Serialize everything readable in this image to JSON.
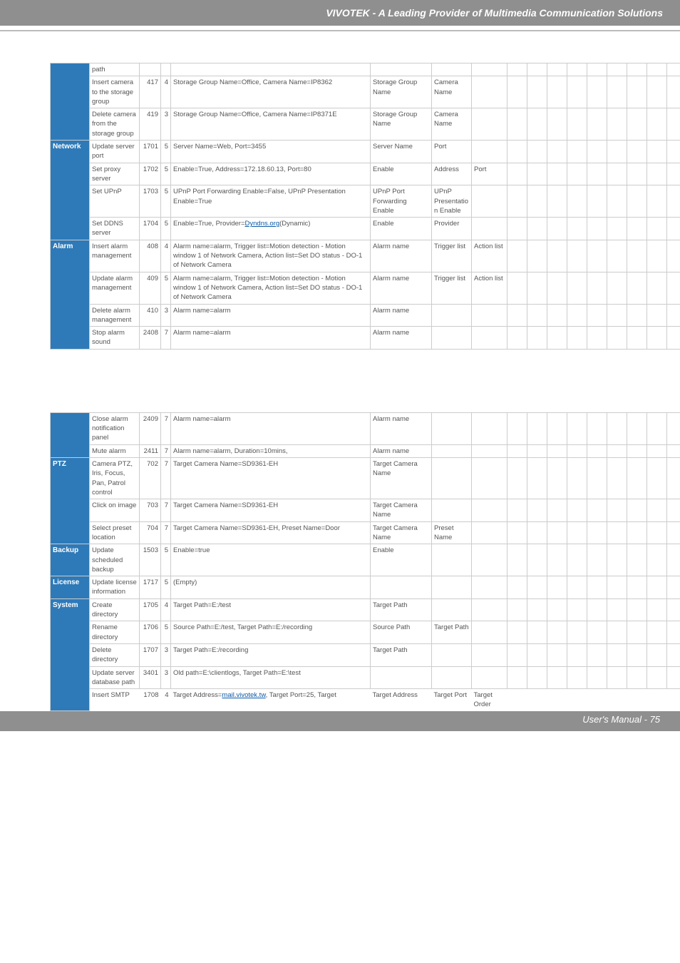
{
  "header": {
    "title": "VIVOTEK - A Leading Provider of Multimedia Communication Solutions"
  },
  "footer": {
    "text": "User's Manual - 75"
  },
  "table1": {
    "rows": [
      {
        "cat": "",
        "action": "path",
        "id": "",
        "n": "",
        "desc": "",
        "p1": "",
        "p2": "",
        "p3": ""
      },
      {
        "cat": "",
        "action": "Insert camera to the storage group",
        "id": "417",
        "n": "4",
        "desc": "Storage Group Name=Office, Camera Name=IP8362",
        "p1": "Storage Group Name",
        "p2": "Camera Name",
        "p3": ""
      },
      {
        "cat": "",
        "action": "Delete camera from the storage group",
        "id": "419",
        "n": "3",
        "desc": "Storage Group Name=Office, Camera Name=IP8371E",
        "p1": "Storage Group Name",
        "p2": "Camera Name",
        "p3": ""
      },
      {
        "cat": "Network",
        "action": "Update server port",
        "id": "1701",
        "n": "5",
        "desc": "Server Name=Web, Port=3455",
        "p1": "Server Name",
        "p2": "Port",
        "p3": ""
      },
      {
        "cat": "",
        "action": "Set proxy server",
        "id": "1702",
        "n": "5",
        "desc": "Enable=True, Address=172.18.60.13, Port=80",
        "p1": "Enable",
        "p2": "Address",
        "p3": "Port"
      },
      {
        "cat": "",
        "action": "Set UPnP",
        "id": "1703",
        "n": "5",
        "desc": "UPnP Port Forwarding Enable=False, UPnP Presentation Enable=True",
        "p1": "UPnP Port Forwarding Enable",
        "p2": "UPnP Presentation Enable",
        "p3": ""
      },
      {
        "cat": "",
        "action": "Set DDNS server",
        "id": "1704",
        "n": "5",
        "desc_prefix": "Enable=True, Provider=",
        "desc_link": "Dyndns.org",
        "desc_suffix": "(Dynamic)",
        "p1": "Enable",
        "p2": "Provider",
        "p3": ""
      },
      {
        "cat": "Alarm",
        "action": "Insert alarm management",
        "id": "408",
        "n": "4",
        "desc": "Alarm name=alarm, Trigger list=Motion detection - Motion window 1 of Network Camera, Action list=Set DO status - DO-1 of Network Camera",
        "p1": "Alarm name",
        "p2": "Trigger list",
        "p3": "Action list"
      },
      {
        "cat": "",
        "action": "Update alarm management",
        "id": "409",
        "n": "5",
        "desc": "Alarm name=alarm, Trigger list=Motion detection - Motion window 1 of Network Camera, Action list=Set DO status - DO-1 of Network Camera",
        "p1": "Alarm name",
        "p2": "Trigger list",
        "p3": "Action list"
      },
      {
        "cat": "",
        "action": "Delete alarm management",
        "id": "410",
        "n": "3",
        "desc": "Alarm name=alarm",
        "p1": "Alarm name",
        "p2": "",
        "p3": ""
      },
      {
        "cat": "",
        "action": "Stop alarm sound",
        "id": "2408",
        "n": "7",
        "desc": "Alarm name=alarm",
        "p1": "Alarm name",
        "p2": "",
        "p3": ""
      }
    ]
  },
  "table2": {
    "rows": [
      {
        "cat": "",
        "action": "Close alarm notification panel",
        "id": "2409",
        "n": "7",
        "desc": "Alarm name=alarm",
        "p1": "Alarm name",
        "p2": "",
        "p3": ""
      },
      {
        "cat": "",
        "action": "Mute alarm",
        "id": "2411",
        "n": "7",
        "desc": "Alarm name=alarm, Duration=10mins,",
        "p1": "Alarm name",
        "p2": "",
        "p3": ""
      },
      {
        "cat": "PTZ",
        "action": "Camera PTZ, Iris, Focus, Pan, Patrol control",
        "id": "702",
        "n": "7",
        "desc": "Target Camera Name=SD9361-EH",
        "p1": "Target Camera Name",
        "p2": "",
        "p3": ""
      },
      {
        "cat": "",
        "action": "Click on image",
        "id": "703",
        "n": "7",
        "desc": "Target Camera Name=SD9361-EH",
        "p1": "Target Camera Name",
        "p2": "",
        "p3": ""
      },
      {
        "cat": "",
        "action": "Select preset location",
        "id": "704",
        "n": "7",
        "desc": "Target Camera Name=SD9361-EH, Preset Name=Door",
        "p1": "Target Camera Name",
        "p2": "Preset Name",
        "p3": ""
      },
      {
        "cat": "Backup",
        "action": "Update scheduled backup",
        "id": "1503",
        "n": "5",
        "desc": "Enable=true",
        "p1": "Enable",
        "p2": "",
        "p3": ""
      },
      {
        "cat": "License",
        "action": "Update license information",
        "id": "1717",
        "n": "5",
        "desc": "(Empty)",
        "p1": "",
        "p2": "",
        "p3": ""
      },
      {
        "cat": "System",
        "action": "Create directory",
        "id": "1705",
        "n": "4",
        "desc": "Target Path=E:/test",
        "p1": "Target Path",
        "p2": "",
        "p3": ""
      },
      {
        "cat": "",
        "action": "Rename directory",
        "id": "1706",
        "n": "5",
        "desc": "Source Path=E:/test, Target Path=E:/recording",
        "p1": "Source Path",
        "p2": "Target Path",
        "p3": ""
      },
      {
        "cat": "",
        "action": "Delete directory",
        "id": "1707",
        "n": "3",
        "desc": "Target Path=E:/recording",
        "p1": "Target Path",
        "p2": "",
        "p3": ""
      },
      {
        "cat": "",
        "action": "Update server database path",
        "id": "3401",
        "n": "3",
        "desc": "Old path=E:\\clientlogs, Target Path=E:\\test",
        "p1": "",
        "p2": "",
        "p3": ""
      },
      {
        "cat": "",
        "action": "Insert SMTP",
        "id": "1708",
        "n": "4",
        "desc_prefix": "Target Address=",
        "desc_link": "mail.vivotek.tw",
        "desc_suffix": ", Target Port=25, Target",
        "p1": "Target Address",
        "p2": "Target Port",
        "p3": "Target Order",
        "noborder": true
      }
    ]
  }
}
